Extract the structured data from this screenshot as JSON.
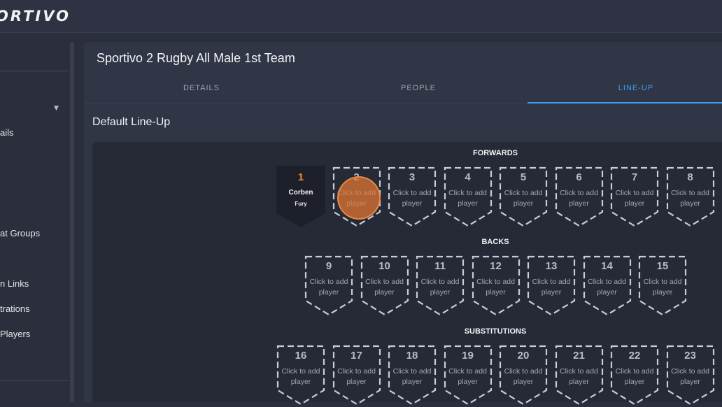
{
  "app": {
    "logo_text": "ORTIVO"
  },
  "sidebar": {
    "items": [
      {
        "label": "ails"
      },
      {
        "label": "at Groups"
      },
      {
        "label": "n Links"
      },
      {
        "label": "trations"
      },
      {
        "label": "Players"
      }
    ]
  },
  "team": {
    "title": "Sportivo 2 Rugby All Male 1st Team",
    "tabs": [
      {
        "label": "DETAILS",
        "active": false
      },
      {
        "label": "PEOPLE",
        "active": false
      },
      {
        "label": "LINE-UP",
        "active": true
      }
    ]
  },
  "lineup": {
    "title": "Default Line-Up",
    "empty_hint_line1": "Click to add",
    "empty_hint_line2": "player",
    "groups": [
      {
        "label": "FORWARDS",
        "slots": [
          {
            "number": "1",
            "player_name": "Corben",
            "player_sub": "Fury"
          },
          {
            "number": "2"
          },
          {
            "number": "3"
          },
          {
            "number": "4"
          },
          {
            "number": "5"
          },
          {
            "number": "6"
          },
          {
            "number": "7"
          },
          {
            "number": "8"
          }
        ]
      },
      {
        "label": "BACKS",
        "slots": [
          {
            "number": "9"
          },
          {
            "number": "10"
          },
          {
            "number": "11"
          },
          {
            "number": "12"
          },
          {
            "number": "13"
          },
          {
            "number": "14"
          },
          {
            "number": "15"
          }
        ]
      },
      {
        "label": "SUBSTITUTIONS",
        "slots": [
          {
            "number": "16"
          },
          {
            "number": "17"
          },
          {
            "number": "18"
          },
          {
            "number": "19"
          },
          {
            "number": "20"
          },
          {
            "number": "21"
          },
          {
            "number": "22"
          },
          {
            "number": "23"
          }
        ]
      }
    ]
  },
  "colors": {
    "accent": "#3aa0e8",
    "filled_number": "#f08a24",
    "cursor": "#e87834"
  }
}
